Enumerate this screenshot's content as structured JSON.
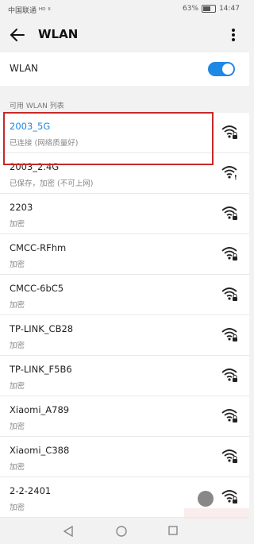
{
  "status": {
    "carrier": "中国联通 ᴴᴰ ᴵᴵ ",
    "battery_percent": "63%",
    "time": "14:47"
  },
  "header": {
    "title": "WLAN"
  },
  "wlan": {
    "label": "WLAN",
    "enabled": true,
    "accent": "#1e88e5"
  },
  "available": {
    "header": "可用 WLAN 列表",
    "networks": [
      {
        "ssid": "2003_5G",
        "status": "已连接 (网络质量好)",
        "connected": true,
        "secure": true
      },
      {
        "ssid": "2003_2.4G",
        "status": "已保存，加密 (不可上网)",
        "connected": false,
        "secure": true,
        "warning": true
      },
      {
        "ssid": "2203",
        "status": "加密",
        "connected": false,
        "secure": true
      },
      {
        "ssid": "CMCC-RFhm",
        "status": "加密",
        "connected": false,
        "secure": true
      },
      {
        "ssid": "CMCC-6bC5",
        "status": "加密",
        "connected": false,
        "secure": true
      },
      {
        "ssid": "TP-LINK_CB28",
        "status": "加密",
        "connected": false,
        "secure": true
      },
      {
        "ssid": "TP-LINK_F5B6",
        "status": "加密",
        "connected": false,
        "secure": true
      },
      {
        "ssid": "Xiaomi_A789",
        "status": "加密",
        "connected": false,
        "secure": true
      },
      {
        "ssid": "Xiaomi_C388",
        "status": "加密",
        "connected": false,
        "secure": true
      },
      {
        "ssid": "2-2-2401",
        "status": "加密",
        "connected": false,
        "secure": true
      }
    ]
  },
  "colors": {
    "highlight": "#c62828",
    "connected_text": "#1e88e5"
  }
}
